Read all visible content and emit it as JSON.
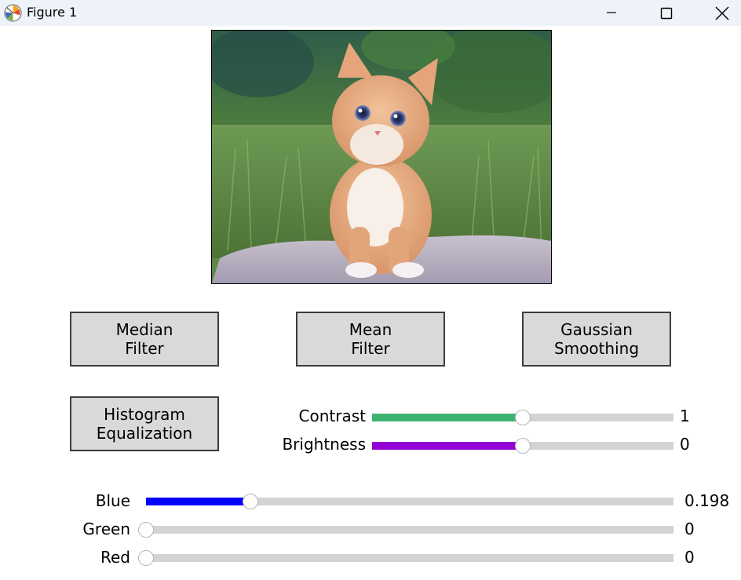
{
  "window": {
    "title": "Figure 1",
    "icon": "matplotlib-icon",
    "controls": [
      "minimize-icon",
      "maximize-icon",
      "close-icon"
    ]
  },
  "image": {
    "subject": "kitten-photo"
  },
  "buttons": {
    "median": "Median\nFilter",
    "mean": "Mean\nFilter",
    "gaussian": "Gaussian\nSmoothing",
    "histogram": "Histogram\nEqualization"
  },
  "sliders": {
    "contrast": {
      "label": "Contrast",
      "value": "1",
      "fraction": 0.5,
      "color": "#3cb371"
    },
    "brightness": {
      "label": "Brightness",
      "value": "0",
      "fraction": 0.5,
      "color": "#9400d3"
    },
    "blue": {
      "label": "Blue",
      "value": "0.198",
      "fraction": 0.198,
      "color": "#0000ff"
    },
    "green": {
      "label": "Green",
      "value": "0",
      "fraction": 0.0,
      "color": "#008000"
    },
    "red": {
      "label": "Red",
      "value": "0",
      "fraction": 0.0,
      "color": "#ff0000"
    }
  }
}
